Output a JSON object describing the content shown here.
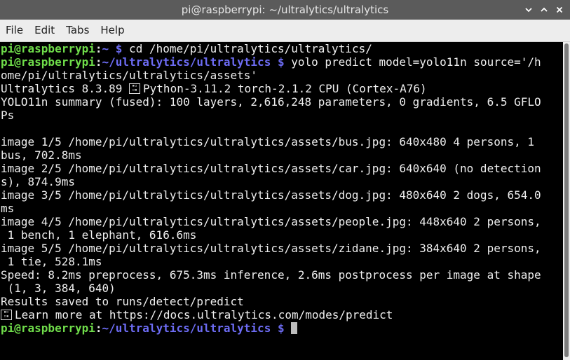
{
  "window": {
    "title": "pi@raspberrypi: ~/ultralytics/ultralytics",
    "controls": {
      "minimize": "⌄",
      "maximize": "⌃",
      "close": "✕"
    }
  },
  "menu": {
    "file": "File",
    "edit": "Edit",
    "tabs": "Tabs",
    "help": "Help"
  },
  "prompt": {
    "user_host": "pi@raspberrypi",
    "sep": ":",
    "home_path": "~",
    "project_path": "~/ultralytics/ultralytics",
    "dollar": "$"
  },
  "terminal": {
    "cmd1": " cd /home/pi/ultralytics/ultralytics/",
    "cmd2": " yolo predict model=yolo11n source='/h",
    "cmd2_cont": "ome/pi/ultralytics/ultralytics/assets'",
    "ver_a": "Ultralytics 8.3.89 ",
    "ver_b": "Python-3.11.2 torch-2.1.2 CPU (Cortex-A76)",
    "summary_a": "YOLO11n summary (fused): 100 layers, 2,616,248 parameters, 0 gradients, 6.5 GFLO",
    "summary_b": "Ps",
    "img1_a": "image 1/5 /home/pi/ultralytics/ultralytics/assets/bus.jpg: 640x480 4 persons, 1",
    "img1_b": "bus, 702.8ms",
    "img2_a": "image 2/5 /home/pi/ultralytics/ultralytics/assets/car.jpg: 640x640 (no detection",
    "img2_b": "s), 874.9ms",
    "img3_a": "image 3/5 /home/pi/ultralytics/ultralytics/assets/dog.jpg: 480x640 2 dogs, 654.0",
    "img3_b": "ms",
    "img4_a": "image 4/5 /home/pi/ultralytics/ultralytics/assets/people.jpg: 448x640 2 persons,",
    "img4_b": " 1 bench, 1 elephant, 616.6ms",
    "img5_a": "image 5/5 /home/pi/ultralytics/ultralytics/assets/zidane.jpg: 384x640 2 persons,",
    "img5_b": " 1 tie, 528.1ms",
    "speed_a": "Speed: 8.2ms preprocess, 675.3ms inference, 2.6ms postprocess per image at shape",
    "speed_b": " (1, 3, 384, 640)",
    "results": "Results saved to runs/detect/predict",
    "learn": "Learn more at https://docs.ultralytics.com/modes/predict"
  },
  "colors": {
    "user_host": "#6fdc4a",
    "path": "#6d6cf4",
    "text": "#eeeeee",
    "background": "#000000",
    "titlebar": "#5b5b5b"
  }
}
